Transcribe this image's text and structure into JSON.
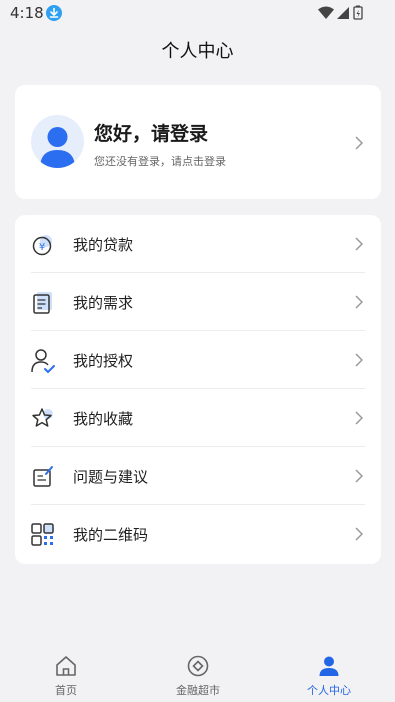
{
  "status": {
    "time": "4:18"
  },
  "header": {
    "title": "个人中心"
  },
  "profile": {
    "greeting": "您好，请登录",
    "subtitle": "您还没有登录，请点击登录"
  },
  "menu": {
    "items": [
      {
        "label": "我的贷款",
        "icon": "loan-yen-icon"
      },
      {
        "label": "我的需求",
        "icon": "document-icon"
      },
      {
        "label": "我的授权",
        "icon": "user-check-icon"
      },
      {
        "label": "我的收藏",
        "icon": "star-icon"
      },
      {
        "label": "问题与建议",
        "icon": "edit-note-icon"
      },
      {
        "label": "我的二维码",
        "icon": "qr-code-icon"
      }
    ]
  },
  "tabbar": {
    "tabs": [
      {
        "label": "首页",
        "icon": "home-icon"
      },
      {
        "label": "金融超市",
        "icon": "target-icon"
      },
      {
        "label": "个人中心",
        "icon": "person-icon",
        "active": true
      }
    ]
  },
  "colors": {
    "accent": "#2266e6",
    "background": "#f2f2f4",
    "card": "#ffffff"
  }
}
